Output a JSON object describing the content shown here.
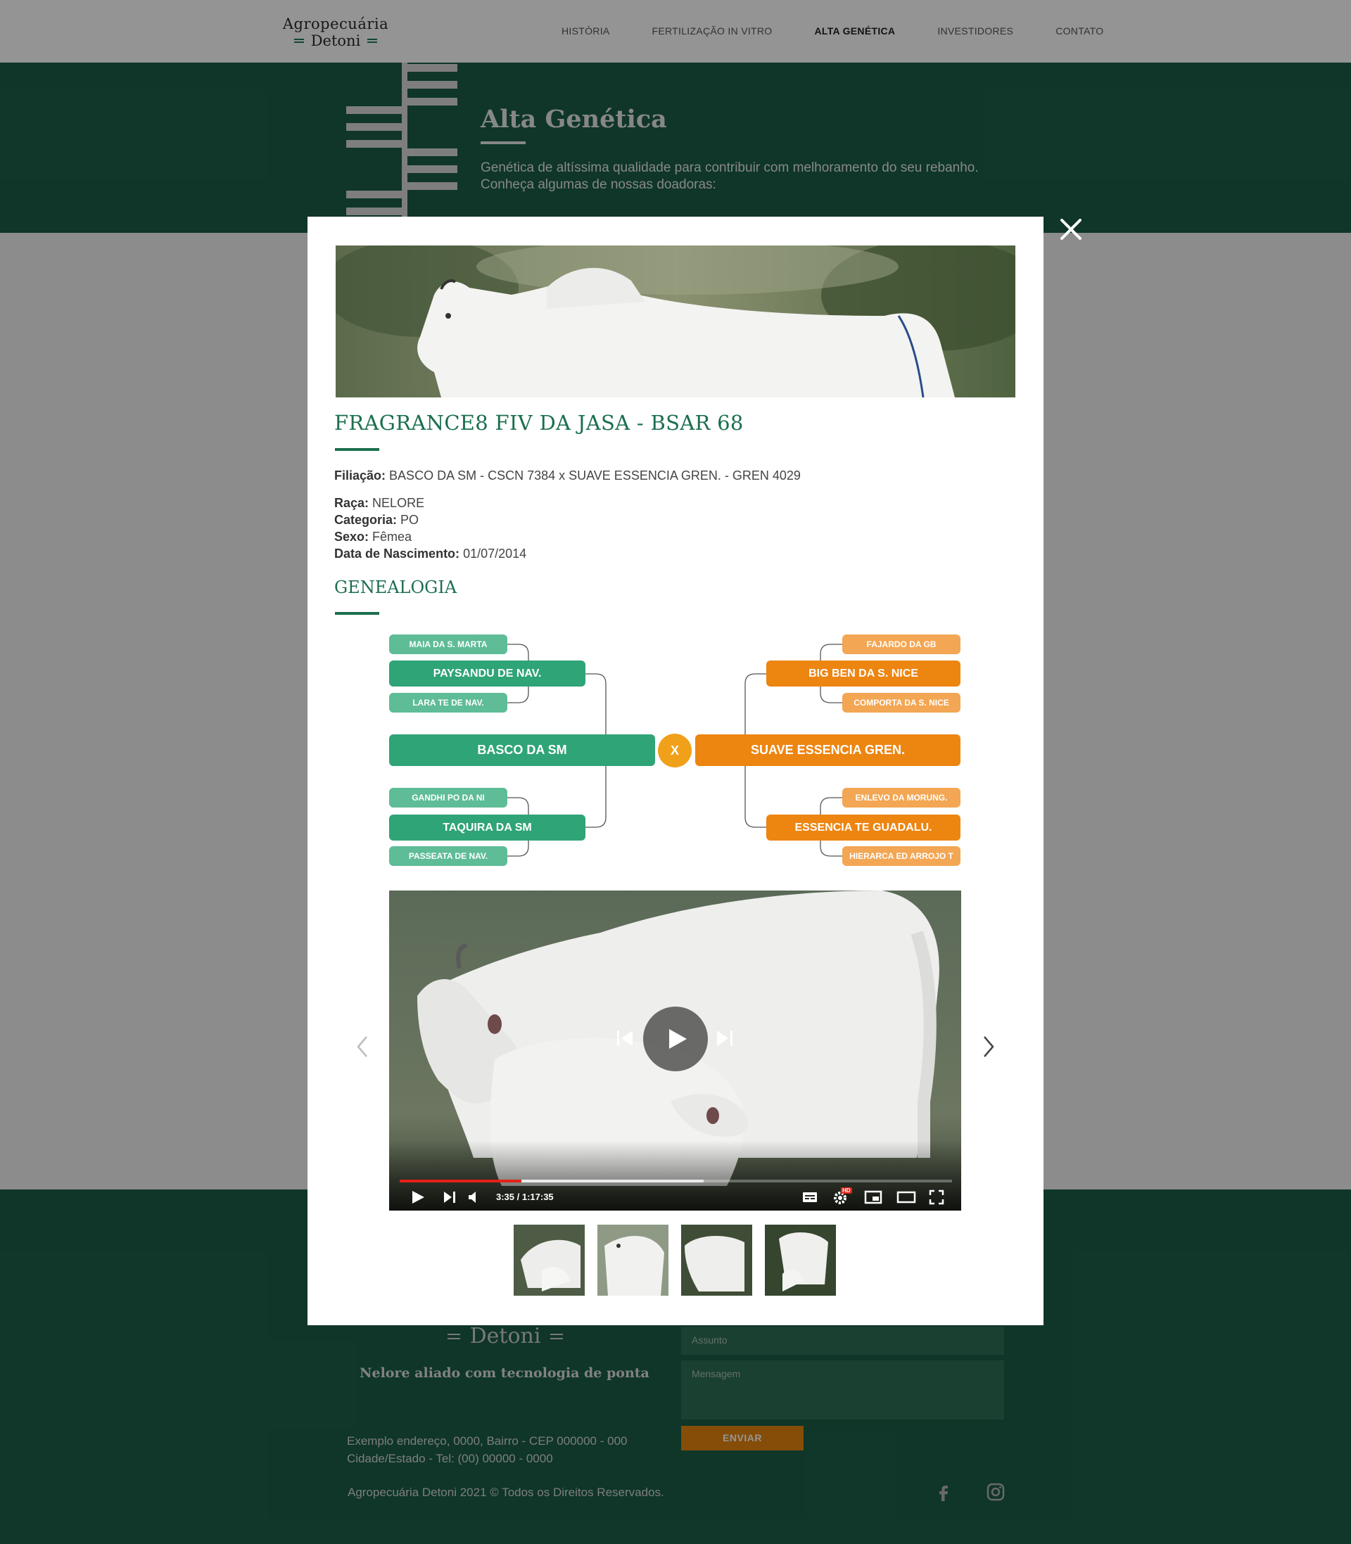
{
  "header": {
    "logo_line1": "Agropecuária",
    "logo_line2": "Detoni",
    "nav": [
      {
        "label": "HISTÓRIA",
        "active": false
      },
      {
        "label": "FERTILIZAÇÃO IN VITRO",
        "active": false
      },
      {
        "label": "ALTA GENÉTICA",
        "active": true
      },
      {
        "label": "INVESTIDORES",
        "active": false
      },
      {
        "label": "CONTATO",
        "active": false
      }
    ]
  },
  "hero": {
    "title": "Alta Genética",
    "text": "Genética de altíssima qualidade para contribuir com melhoramento do seu rebanho. Conheça algumas de nossas doadoras:"
  },
  "modal": {
    "title": "FRAGRANCE8 FIV DA JASA - BSAR 68",
    "filiacao_label": "Filiação:",
    "filiacao_value": "BASCO DA SM - CSCN 7384 x SUAVE ESSENCIA GREN. - GREN 4029",
    "raca_label": "Raça:",
    "raca_value": "NELORE",
    "categoria_label": "Categoria:",
    "categoria_value": "PO",
    "sexo_label": "Sexo:",
    "sexo_value": "Fêmea",
    "nascimento_label": "Data de Nascimento:",
    "nascimento_value": "01/07/2014",
    "genealogia_title": "GENEALOGIA",
    "genealogy": {
      "sire": "BASCO DA SM",
      "dam": "SUAVE ESSENCIA GREN.",
      "separator": "X",
      "sire_sire": "PAYSANDU DE NAV.",
      "sire_sire_sire": "MAIA DA S. MARTA",
      "sire_sire_dam": "LARA TE DE NAV.",
      "sire_dam": "TAQUIRA DA SM",
      "sire_dam_sire": "GANDHI PO DA NI",
      "sire_dam_dam": "PASSEATA DE NAV.",
      "dam_sire": "BIG BEN DA S. NICE",
      "dam_sire_sire": "FAJARDO DA GB",
      "dam_sire_dam": "COMPORTA DA S. NICE",
      "dam_dam": "ESSENCIA TE GUADALU.",
      "dam_dam_sire": "ENLEVO DA MORUNG.",
      "dam_dam_dam": "HIERARCA ED ARROJO T"
    },
    "video": {
      "time": "3:35 / 1:17:35",
      "progress_played": 0.22,
      "progress_buffered": 0.55,
      "hd_badge": "HD"
    },
    "thumbnails_count": 4
  },
  "footer": {
    "logo_text": "Detoni",
    "tagline": "Nelore aliado com tecnologia de ponta",
    "address_line1": "Exemplo endereço, 0000, Bairro - CEP 000000 - 000",
    "address_line2": "Cidade/Estado - Tel: (00) 00000 - 0000",
    "copyright": "Agropecuária Detoni 2021 © Todos os Direitos Reservados.",
    "subject_placeholder": "Assunto",
    "message_placeholder": "Mensagem",
    "send_label": "ENVIAR"
  },
  "colors": {
    "brand_green": "#1b5e46",
    "accent_green": "#2fa477",
    "accent_orange": "#ed8511",
    "overlay": "rgba(0,0,0,0.42)"
  },
  "icons": [
    "close-icon",
    "chevron-left-icon",
    "chevron-right-icon",
    "play-icon",
    "previous-icon",
    "next-icon",
    "volume-icon",
    "subtitles-icon",
    "settings-icon",
    "miniplayer-icon",
    "theater-icon",
    "fullscreen-icon",
    "facebook-icon",
    "instagram-icon"
  ]
}
